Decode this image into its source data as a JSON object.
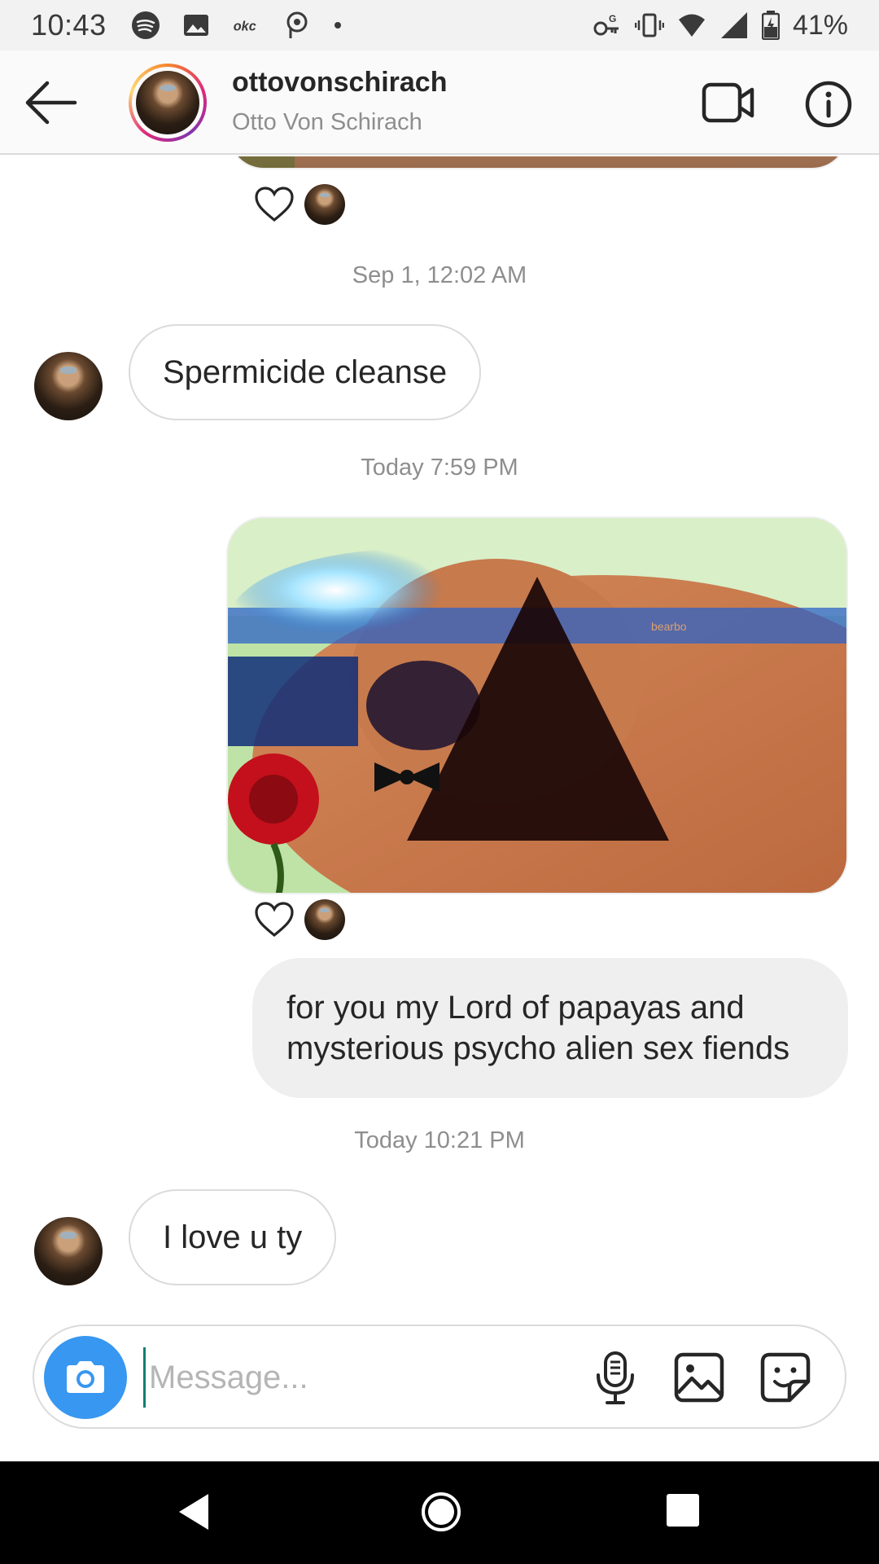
{
  "status_bar": {
    "time": "10:43",
    "battery_percent": "41%",
    "left_icons": [
      "spotify-icon",
      "image-icon",
      "okc-icon",
      "podcast-icon",
      "dot-icon"
    ],
    "right_icons": [
      "vpn-key-icon",
      "vibrate-icon",
      "wifi-icon",
      "signal-icon",
      "battery-icon"
    ]
  },
  "header": {
    "username": "ottovonschirach",
    "full_name": "Otto Von Schirach"
  },
  "messages": [
    {
      "type": "timestamp",
      "text": "Sep 1, 12:02 AM"
    },
    {
      "type": "incoming",
      "text": "Spermicide cleanse"
    },
    {
      "type": "timestamp",
      "text": "Today 7:59 PM"
    },
    {
      "type": "outgoing-photo",
      "watermark": "bearbo"
    },
    {
      "type": "outgoing",
      "text": "for you my Lord of papayas and mysterious psycho alien sex fiends"
    },
    {
      "type": "timestamp",
      "text": "Today 10:21 PM"
    },
    {
      "type": "incoming",
      "text": "I love u ty"
    }
  ],
  "composer": {
    "placeholder": "Message..."
  },
  "colors": {
    "accent_blue": "#3897f0",
    "bubble_outgoing": "#efefef",
    "border": "#dbdbdb",
    "meta_text": "#8e8e8e"
  }
}
